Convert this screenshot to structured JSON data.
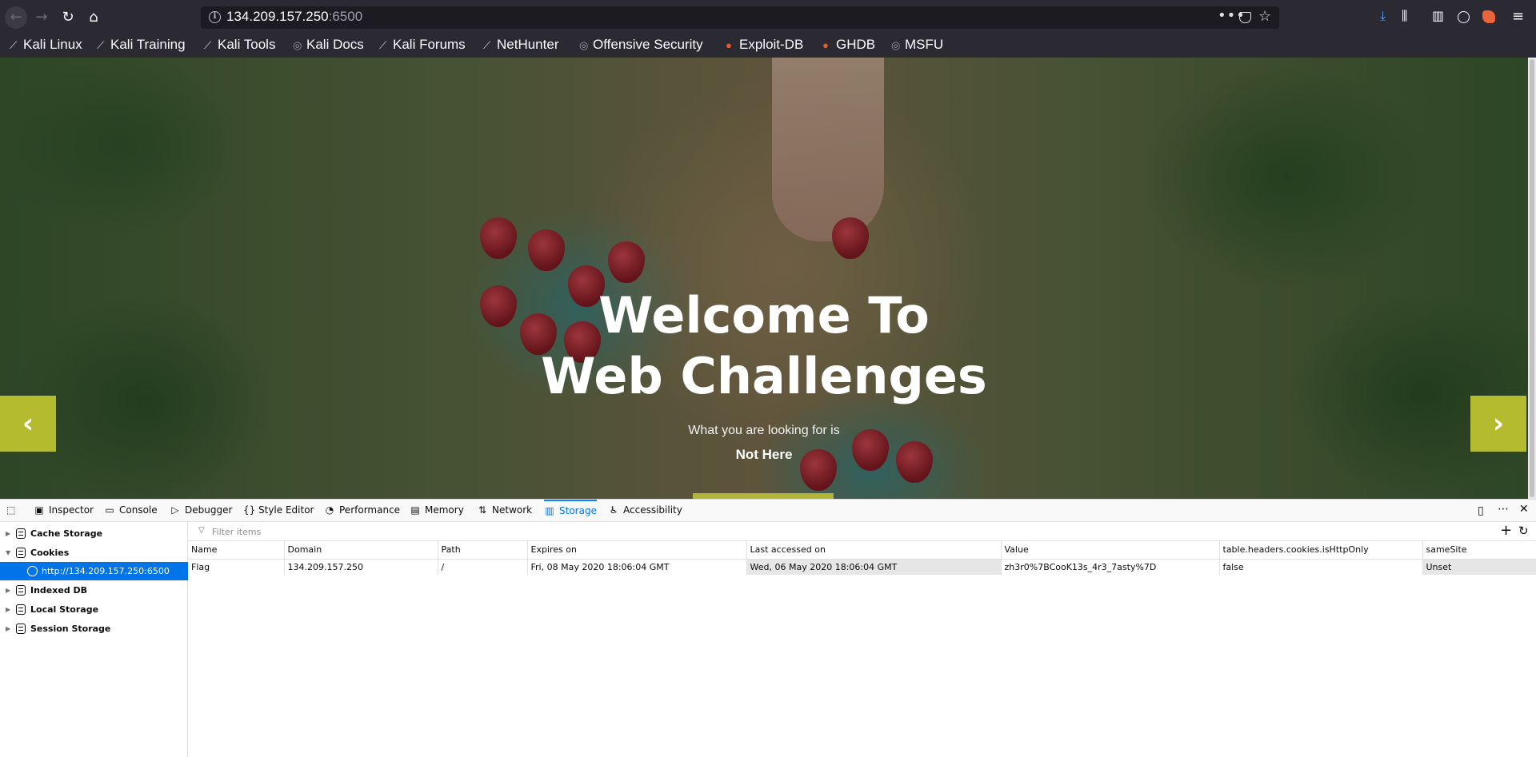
{
  "browser": {
    "url_host": "134.209.157.250",
    "url_port": ":6500",
    "url_more": "•••",
    "url_star": "☆",
    "icons": {
      "back": "arrow-left-icon",
      "forward": "arrow-right-icon",
      "reload": "reload-icon",
      "home": "home-icon",
      "info": "info-icon",
      "download": "download-icon",
      "library": "library-icon",
      "sidebar": "sidebar-icon",
      "account": "account-icon",
      "extension": "extension-icon",
      "menu": "hamburger-menu-icon"
    }
  },
  "bookmarks": [
    {
      "label": "Kali Linux",
      "icon": "kali-icon"
    },
    {
      "label": "Kali Training",
      "icon": "kali-icon"
    },
    {
      "label": "Kali Tools",
      "icon": "kali-icon"
    },
    {
      "label": "Kali Docs",
      "icon": "globe-icon"
    },
    {
      "label": "Kali Forums",
      "icon": "kali-icon"
    },
    {
      "label": "NetHunter",
      "icon": "kali-icon"
    },
    {
      "label": "Offensive Security",
      "icon": "globe-icon"
    },
    {
      "label": "Exploit-DB",
      "icon": "exploit-db-icon"
    },
    {
      "label": "GHDB",
      "icon": "exploit-db-icon"
    },
    {
      "label": "MSFU",
      "icon": "globe-icon"
    }
  ],
  "hero": {
    "title_line1": "Welcome To",
    "title_line2": "Web Challenges",
    "subtitle": "What you are looking for is",
    "note": "Not Here",
    "prev": "‹",
    "next": "›"
  },
  "devtools": {
    "tabs": [
      {
        "label": "Inspector",
        "icon": "inspector-icon"
      },
      {
        "label": "Console",
        "icon": "console-icon"
      },
      {
        "label": "Debugger",
        "icon": "debugger-icon"
      },
      {
        "label": "Style Editor",
        "icon": "style-editor-icon"
      },
      {
        "label": "Performance",
        "icon": "performance-icon"
      },
      {
        "label": "Memory",
        "icon": "memory-icon"
      },
      {
        "label": "Network",
        "icon": "network-icon"
      },
      {
        "label": "Storage",
        "icon": "storage-icon",
        "active": true
      },
      {
        "label": "Accessibility",
        "icon": "accessibility-icon"
      }
    ],
    "sidebar": [
      {
        "label": "Cache Storage",
        "expanded": false
      },
      {
        "label": "Cookies",
        "expanded": true
      },
      {
        "label": "http://134.209.157.250:6500",
        "selected": true
      },
      {
        "label": "Indexed DB",
        "expanded": false
      },
      {
        "label": "Local Storage",
        "expanded": false
      },
      {
        "label": "Session Storage",
        "expanded": false
      }
    ],
    "filter_placeholder": "Filter items",
    "table": {
      "headers": [
        "Name",
        "Domain",
        "Path",
        "Expires on",
        "Last accessed on",
        "Value",
        "table.headers.cookies.isHttpOnly",
        "sameSite"
      ],
      "rows": [
        [
          "Flag",
          "134.209.157.250",
          "/",
          "Fri, 08 May 2020 18:06:04 GMT",
          "Wed, 06 May 2020 18:06:04 GMT",
          "zh3r0%7BCooK13s_4r3_7asty%7D",
          "false",
          "Unset"
        ]
      ]
    },
    "colors": {
      "accent": "#0074e8",
      "arrow": "#b4bb2e"
    }
  }
}
